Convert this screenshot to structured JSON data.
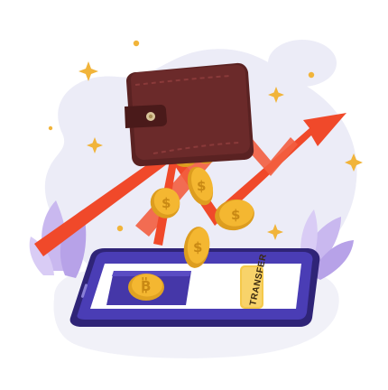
{
  "illustration": {
    "phone": {
      "transfer_button_label": "TRANSFER",
      "coin_card_symbol": "bitcoin-icon"
    },
    "wallet": {
      "icon": "wallet-icon"
    },
    "decorations": {
      "arrow_icon": "growth-arrow-icon",
      "sparkle_icon": "sparkle-icon",
      "leaf_icon": "leaf-icon",
      "coin_icon": "dollar-coin-icon"
    },
    "colors": {
      "background_blob": "#ececf7",
      "arrow": "#f0492a",
      "wallet": "#6b2a2a",
      "coin": "#f4b731",
      "phone_frame": "#3b2f8f",
      "phone_card": "#4537a8",
      "transfer_button": "#f5c94a",
      "leaves": "#c9b8ef",
      "sparkle": "#f1b43a"
    }
  }
}
